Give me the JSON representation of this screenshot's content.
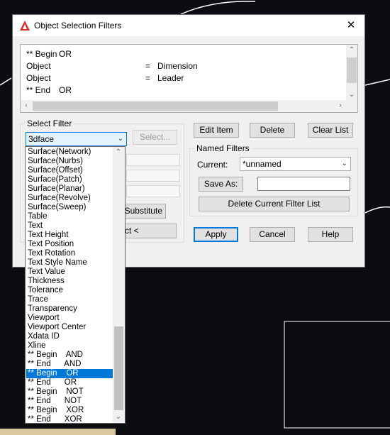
{
  "dialog": {
    "title": "Object Selection Filters",
    "close_glyph": "✕",
    "filter_list": {
      "rows": [
        {
          "col1": "** Begin",
          "col2": "OR",
          "col3": "",
          "col4": ""
        },
        {
          "col1": "Object",
          "col2": "",
          "col3": "=",
          "col4": "Dimension"
        },
        {
          "col1": "Object",
          "col2": "",
          "col3": "=",
          "col4": "Leader"
        },
        {
          "col1": "** End",
          "col2": "OR",
          "col3": "",
          "col4": ""
        }
      ]
    },
    "select_filter": {
      "group_label": "Select Filter",
      "combo_value": "3dface",
      "select_button": "Select...",
      "substitute_button": "Substitute",
      "add_selected_button": "ct <"
    },
    "buttons": {
      "edit_item": "Edit Item",
      "delete": "Delete",
      "clear_list": "Clear List",
      "apply": "Apply",
      "cancel": "Cancel",
      "help": "Help"
    },
    "named_filters": {
      "group_label": "Named Filters",
      "current_label": "Current:",
      "current_value": "*unnamed",
      "save_as_button": "Save As:",
      "save_as_value": "",
      "delete_button": "Delete Current Filter List"
    }
  },
  "dropdown": {
    "items": [
      "Surface(Network)",
      "Surface(Nurbs)",
      "Surface(Offset)",
      "Surface(Patch)",
      "Surface(Planar)",
      "Surface(Revolve)",
      "Surface(Sweep)",
      "Table",
      "Text",
      "Text Height",
      "Text Position",
      "Text Rotation",
      "Text Style Name",
      "Text Value",
      "Thickness",
      "Tolerance",
      "Trace",
      "Transparency",
      "Viewport",
      "Viewport Center",
      "Xdata ID",
      "Xline",
      "** Begin    AND",
      "** End      AND",
      "** Begin    OR",
      "** End      OR",
      "** Begin    NOT",
      "** End      NOT",
      "** Begin    XOR",
      "** End      XOR"
    ],
    "selected_index": 24
  },
  "colors": {
    "accent": "#0078d7",
    "canvas_background": "#0b0d12",
    "title_icon": "#d32f2f"
  }
}
